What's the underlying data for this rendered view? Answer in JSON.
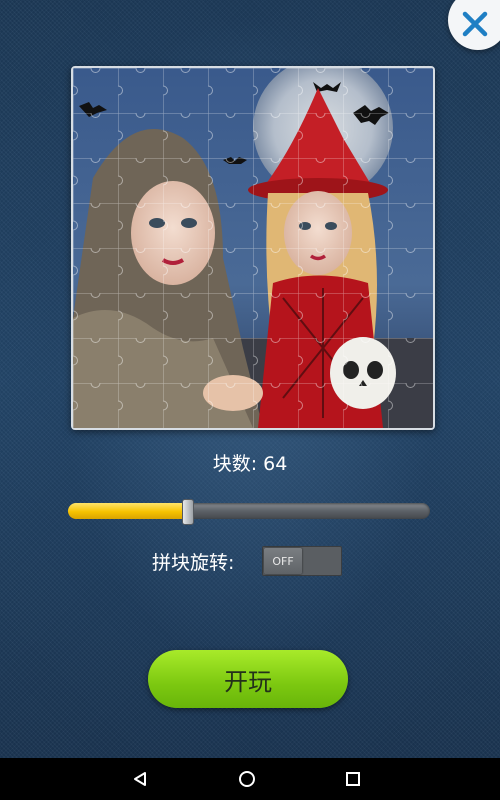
{
  "dialog": {
    "close_icon": "close-x-icon",
    "image_description_icon": "halloween-puzzle-image",
    "piece_count_label": "块数: 64",
    "piece_slider": {
      "value_fraction": 0.33
    },
    "rotation": {
      "label": "拼块旋转:",
      "toggle_state": "OFF"
    },
    "play_button_label": "开玩"
  },
  "navigation_bar": {
    "back_icon": "triangle-back-icon",
    "home_icon": "circle-home-icon",
    "recents_icon": "square-recents-icon"
  },
  "colors": {
    "accent_green": "#8fd81a",
    "slider_yellow": "#f6c200",
    "close_blue": "#1f7fc4",
    "background_blue": "#1f3d5c"
  }
}
